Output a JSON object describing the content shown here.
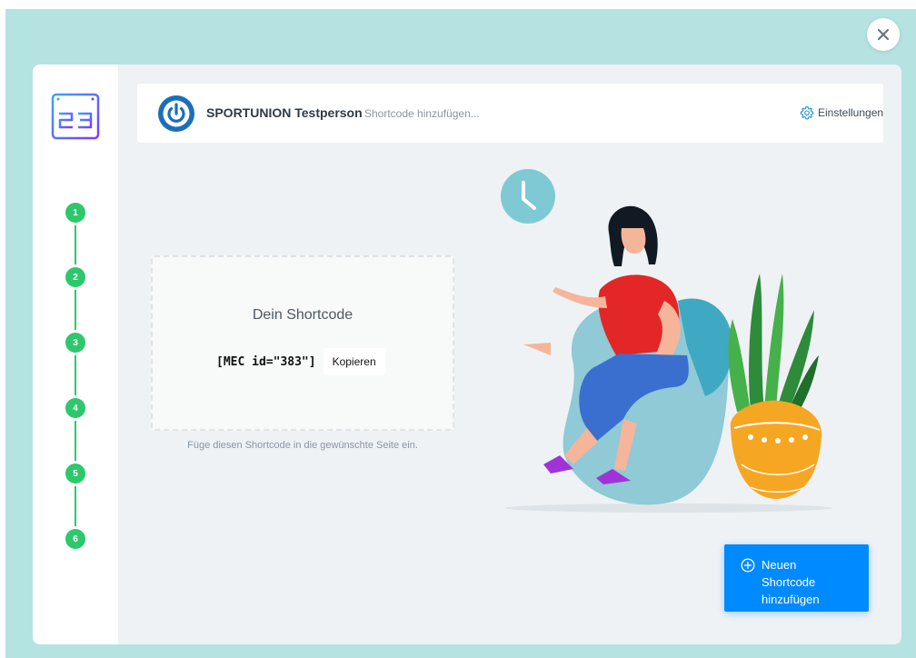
{
  "header": {
    "brand_name": "SPORTUNION Testperson",
    "subtitle": "Shortcode hinzufügen...",
    "settings_label": "Einstellungen"
  },
  "steps": [
    "1",
    "2",
    "3",
    "4",
    "5",
    "6"
  ],
  "shortcode": {
    "title": "Dein Shortcode",
    "code": "[MEC id=\"383\"]",
    "copy_label": "Kopieren",
    "hint": "Füge diesen Shortcode in die gewünschte Seite ein."
  },
  "actions": {
    "new_shortcode_label": "Neuen Shortcode hinzufügen"
  },
  "icons": {
    "close": "close-icon",
    "logo": "calendar-23-logo",
    "brand": "power-icon",
    "settings": "gear-icon",
    "add": "plus-circle-icon"
  },
  "colors": {
    "backdrop": "#b5e3e2",
    "step_green": "#2dc86b",
    "primary_blue": "#008aff",
    "brand_blue": "#1a6fb8"
  }
}
